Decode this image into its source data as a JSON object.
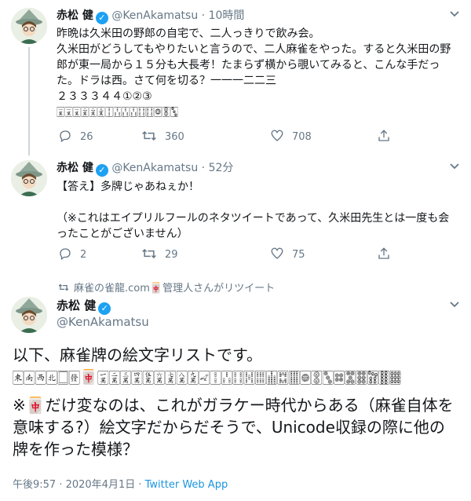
{
  "tweets": [
    {
      "name": "赤松 健",
      "handle": "@KenAkamatsu",
      "separator": "·",
      "time": "10時間",
      "text": "昨晩は久米田の野郎の自宅で、二人っきりで飲み会。\n久米田がどうしてもやりたいと言うので、二人麻雀をやった。すると久米田の野郎が東一局から１５分も大長考！たまらず横から覗いてみると、こんな手だった。ドラは西。さて何を切る？一一一二二三\n２３３３４４①②③",
      "tiles": "🀇🀇🀇🀈🀈🀉🀑🀒🀒🀒🀓🀓🀙🀚🀛",
      "counts": {
        "reply": "26",
        "retweet": "360",
        "like": "708"
      }
    },
    {
      "name": "赤松 健",
      "handle": "@KenAkamatsu",
      "separator": "·",
      "time": "52分",
      "text": "【答え】多牌じゃあねぇか！\n\n（※これはエイプリルフールのネタツイートであって、久米田先生とは一度も会ったことがございません）",
      "counts": {
        "reply": "2",
        "retweet": "29",
        "like": "75"
      }
    }
  ],
  "retweet_note": "麻雀の雀龍.com🀄管理人さんがリツイート",
  "main_tweet": {
    "name": "赤松 健",
    "handle": "@KenAkamatsu",
    "text_line1": "以下、麻雀牌の絵文字リストです。",
    "tiles_before": "🀀🀁🀂🀃🀆🀅",
    "tiles_red": "🀄",
    "tiles_after": "🀇🀈🀉🀊🀋🀌🀍🀎🀏🀐🀑🀒🀓🀔🀕🀖🀗🀘🀙🀚🀛🀜🀝🀞🀟🀠🀡",
    "note_prefix": "※",
    "note_red": "🀄",
    "note_rest": "だけ変なのは、これがガラケー時代からある（麻雀自体を意味する?）絵文字だからだそうで、Unicode収録の際に他の牌を作った模様？",
    "timestamp": "午後9:57 · 2020年4月1日 · ",
    "via": "Twitter Web App"
  },
  "colors": {
    "accent": "#1da1f2",
    "muted": "#657786",
    "red_tile": "#cc1f1f"
  },
  "icons": [
    "verified-badge-icon",
    "chevron-down-icon",
    "reply-icon",
    "retweet-icon",
    "like-icon",
    "share-icon"
  ]
}
